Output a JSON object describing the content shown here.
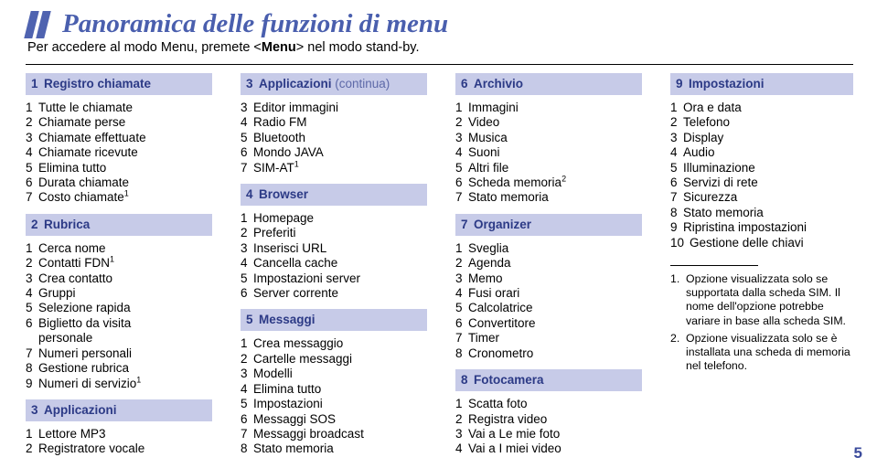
{
  "header": {
    "title": "Panoramica delle funzioni di menu",
    "logo_icon": "double-slash-logo-icon",
    "subtitle_pre": "Per accedere al modo Menu, premete <",
    "subtitle_bold": "Menu",
    "subtitle_post": "> nel modo stand-by.",
    "accent_color": "#4a5fae",
    "header_bg_color": "#c7cbe8"
  },
  "page_number": "5",
  "columns": [
    {
      "sections": [
        {
          "number": "1",
          "label": "Registro chiamate",
          "continued": "",
          "items": [
            {
              "n": "1",
              "t": "Tutte le chiamate"
            },
            {
              "n": "2",
              "t": "Chiamate perse"
            },
            {
              "n": "3",
              "t": "Chiamate effettuate"
            },
            {
              "n": "4",
              "t": "Chiamate ricevute"
            },
            {
              "n": "5",
              "t": "Elimina tutto"
            },
            {
              "n": "6",
              "t": "Durata chiamate"
            },
            {
              "n": "7",
              "t": "Costo chiamate",
              "sup": "1"
            }
          ]
        },
        {
          "number": "2",
          "label": "Rubrica",
          "continued": "",
          "items": [
            {
              "n": "1",
              "t": "Cerca nome"
            },
            {
              "n": "2",
              "t": "Contatti FDN",
              "sup": "1"
            },
            {
              "n": "3",
              "t": "Crea contatto"
            },
            {
              "n": "4",
              "t": "Gruppi"
            },
            {
              "n": "5",
              "t": "Selezione rapida"
            },
            {
              "n": "6",
              "t": "Biglietto da visita",
              "t2": "personale"
            },
            {
              "n": "7",
              "t": "Numeri personali"
            },
            {
              "n": "8",
              "t": "Gestione rubrica"
            },
            {
              "n": "9",
              "t": "Numeri di servizio",
              "sup": "1"
            }
          ]
        },
        {
          "number": "3",
          "label": "Applicazioni",
          "continued": "",
          "items": [
            {
              "n": "1",
              "t": "Lettore MP3"
            },
            {
              "n": "2",
              "t": "Registratore vocale"
            }
          ]
        }
      ]
    },
    {
      "sections": [
        {
          "number": "3",
          "label": "Applicazioni",
          "continued": "(continua)",
          "items": [
            {
              "n": "3",
              "t": "Editor immagini"
            },
            {
              "n": "4",
              "t": "Radio FM"
            },
            {
              "n": "5",
              "t": "Bluetooth"
            },
            {
              "n": "6",
              "t": "Mondo JAVA"
            },
            {
              "n": "7",
              "t": "SIM-AT",
              "sup": "1"
            }
          ]
        },
        {
          "number": "4",
          "label": "Browser",
          "continued": "",
          "items": [
            {
              "n": "1",
              "t": "Homepage"
            },
            {
              "n": "2",
              "t": "Preferiti"
            },
            {
              "n": "3",
              "t": "Inserisci URL"
            },
            {
              "n": "4",
              "t": "Cancella cache"
            },
            {
              "n": "5",
              "t": "Impostazioni server"
            },
            {
              "n": "6",
              "t": "Server corrente"
            }
          ]
        },
        {
          "number": "5",
          "label": "Messaggi",
          "continued": "",
          "items": [
            {
              "n": "1",
              "t": "Crea messaggio"
            },
            {
              "n": "2",
              "t": "Cartelle messaggi"
            },
            {
              "n": "3",
              "t": "Modelli"
            },
            {
              "n": "4",
              "t": "Elimina tutto"
            },
            {
              "n": "5",
              "t": "Impostazioni"
            },
            {
              "n": "6",
              "t": "Messaggi SOS"
            },
            {
              "n": "7",
              "t": "Messaggi broadcast"
            },
            {
              "n": "8",
              "t": "Stato memoria"
            }
          ]
        }
      ]
    },
    {
      "sections": [
        {
          "number": "6",
          "label": "Archivio",
          "continued": "",
          "items": [
            {
              "n": "1",
              "t": "Immagini"
            },
            {
              "n": "2",
              "t": "Video"
            },
            {
              "n": "3",
              "t": "Musica"
            },
            {
              "n": "4",
              "t": "Suoni"
            },
            {
              "n": "5",
              "t": "Altri file"
            },
            {
              "n": "6",
              "t": "Scheda memoria",
              "sup": "2"
            },
            {
              "n": "7",
              "t": "Stato memoria"
            }
          ]
        },
        {
          "number": "7",
          "label": "Organizer",
          "continued": "",
          "items": [
            {
              "n": "1",
              "t": "Sveglia"
            },
            {
              "n": "2",
              "t": "Agenda"
            },
            {
              "n": "3",
              "t": "Memo"
            },
            {
              "n": "4",
              "t": "Fusi orari"
            },
            {
              "n": "5",
              "t": "Calcolatrice"
            },
            {
              "n": "6",
              "t": "Convertitore"
            },
            {
              "n": "7",
              "t": "Timer"
            },
            {
              "n": "8",
              "t": "Cronometro"
            }
          ]
        },
        {
          "number": "8",
          "label": "Fotocamera",
          "continued": "",
          "items": [
            {
              "n": "1",
              "t": "Scatta foto"
            },
            {
              "n": "2",
              "t": "Registra video"
            },
            {
              "n": "3",
              "t": "Vai a Le mie foto"
            },
            {
              "n": "4",
              "t": "Vai a I miei video"
            }
          ]
        }
      ]
    },
    {
      "sections": [
        {
          "number": "9",
          "label": "Impostazioni",
          "continued": "",
          "items": [
            {
              "n": "1",
              "t": "Ora e data"
            },
            {
              "n": "2",
              "t": "Telefono"
            },
            {
              "n": "3",
              "t": "Display"
            },
            {
              "n": "4",
              "t": "Audio"
            },
            {
              "n": "5",
              "t": "Illuminazione"
            },
            {
              "n": "6",
              "t": "Servizi di rete"
            },
            {
              "n": "7",
              "t": "Sicurezza"
            },
            {
              "n": "8",
              "t": "Stato memoria"
            },
            {
              "n": "9",
              "t": "Ripristina impostazioni"
            },
            {
              "n": "10",
              "t": "Gestione delle chiavi",
              "wide": true
            }
          ]
        }
      ],
      "footnotes": [
        {
          "n": "1.",
          "t": "Opzione visualizzata solo se supportata dalla scheda SIM. Il nome dell'opzione potrebbe variare in base alla scheda SIM."
        },
        {
          "n": "2.",
          "t": "Opzione visualizzata solo se è installata una scheda di memoria nel telefono."
        }
      ]
    }
  ]
}
